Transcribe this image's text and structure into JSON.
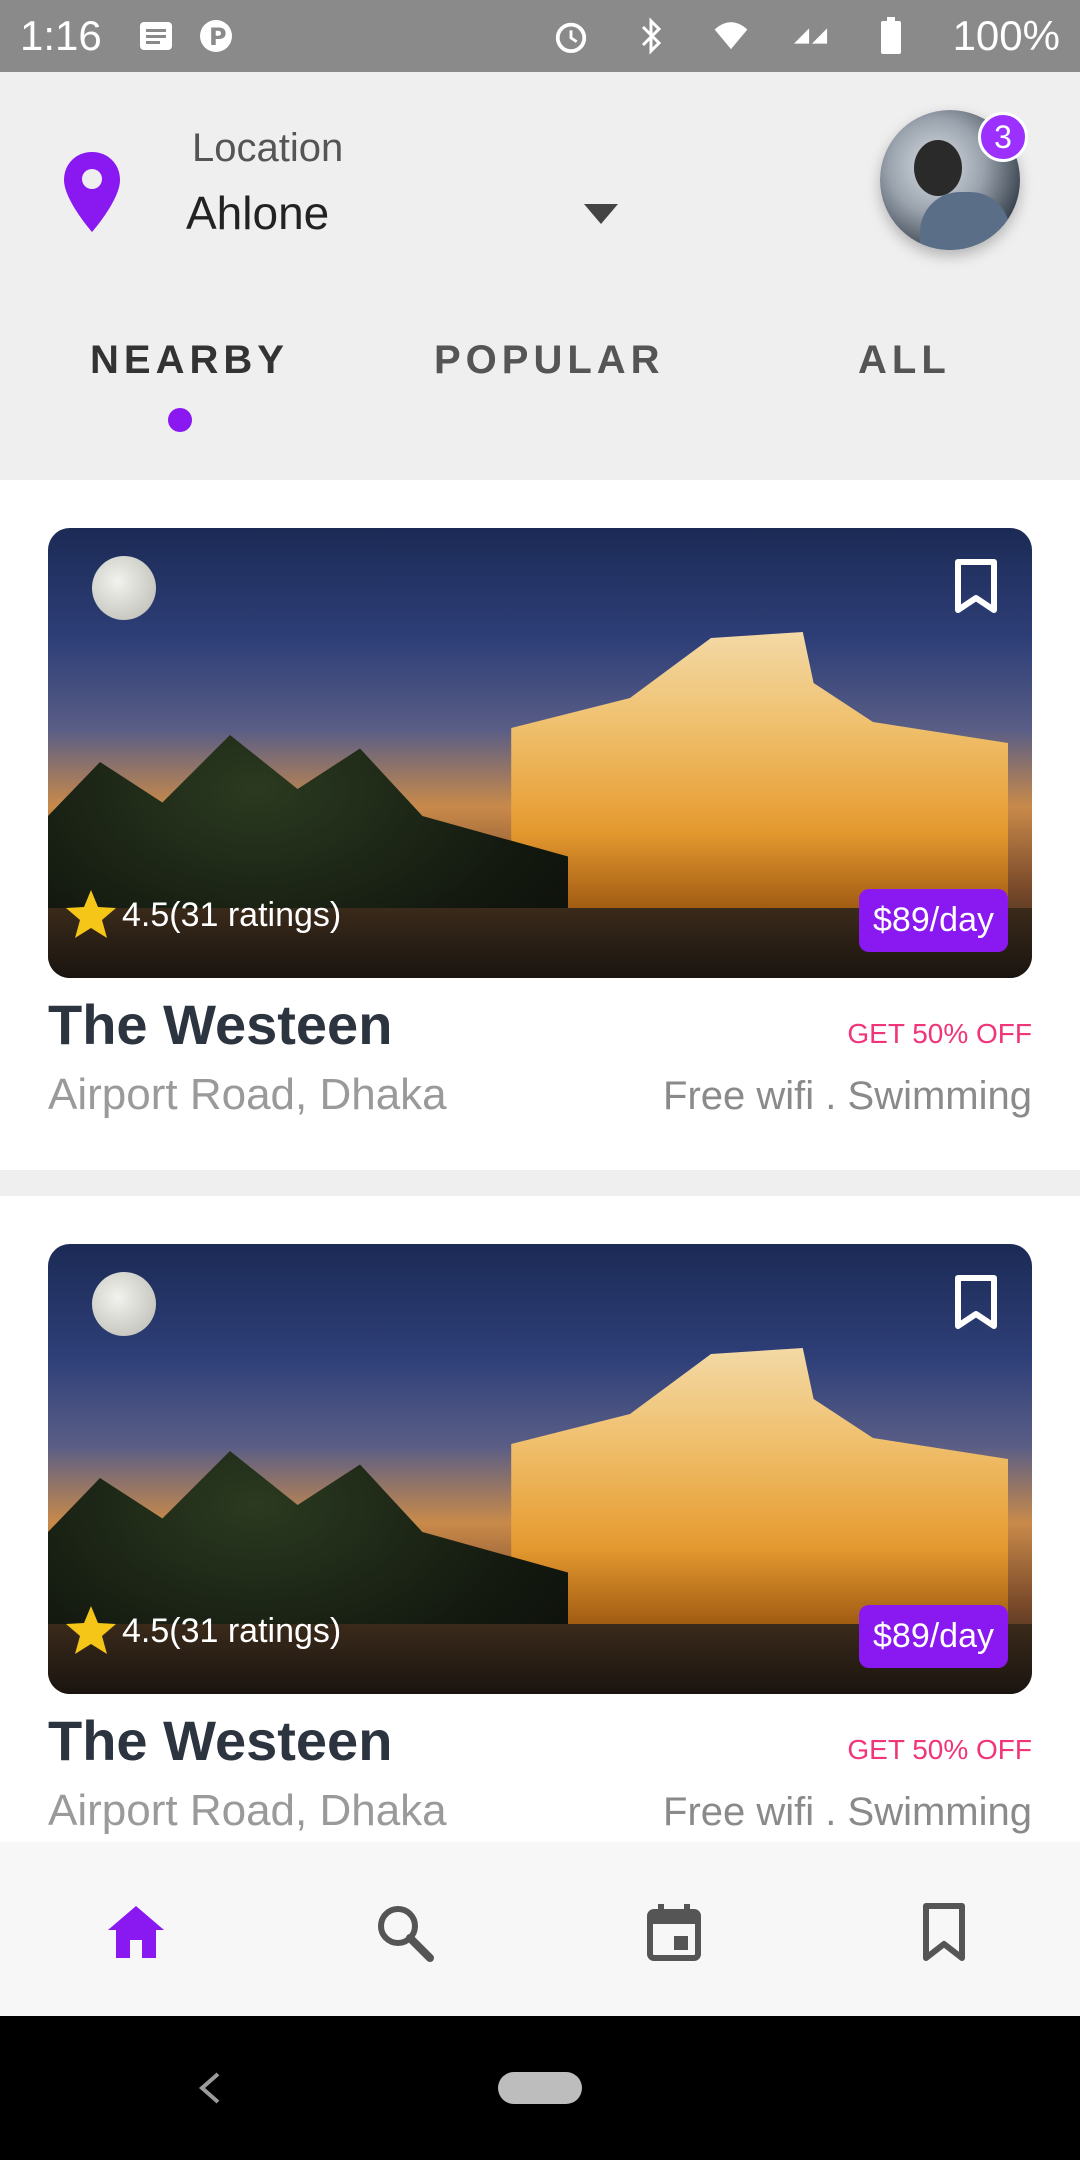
{
  "status_bar": {
    "time": "1:16",
    "battery": "100%",
    "icons": [
      "notification-icon",
      "parking-icon",
      "alarm-icon",
      "bluetooth-icon",
      "wifi-icon",
      "signal-icon",
      "battery-icon"
    ]
  },
  "header": {
    "location_label": "Location",
    "location_value": "Ahlone",
    "notification_count": "3"
  },
  "tabs": [
    {
      "label": "NEARBY",
      "active": true
    },
    {
      "label": "POPULAR",
      "active": false
    },
    {
      "label": "ALL",
      "active": false
    }
  ],
  "hotels": [
    {
      "name": "The Westeen",
      "address": "Airport Road, Dhaka",
      "rating_text": "4.5(31 ratings)",
      "price": "$89/day",
      "offer": "GET 50% OFF",
      "amenities": "Free wifi . Swimming"
    },
    {
      "name": "The Westeen",
      "address": "Airport Road, Dhaka",
      "rating_text": "4.5(31 ratings)",
      "price": "$89/day",
      "offer": "GET 50% OFF",
      "amenities": "Free wifi . Swimming"
    }
  ],
  "bottom_nav": [
    "home-icon",
    "search-icon",
    "calendar-icon",
    "bookmark-icon"
  ],
  "colors": {
    "accent": "#8a18f0",
    "offer": "#f0357a",
    "star": "#f5c518"
  }
}
